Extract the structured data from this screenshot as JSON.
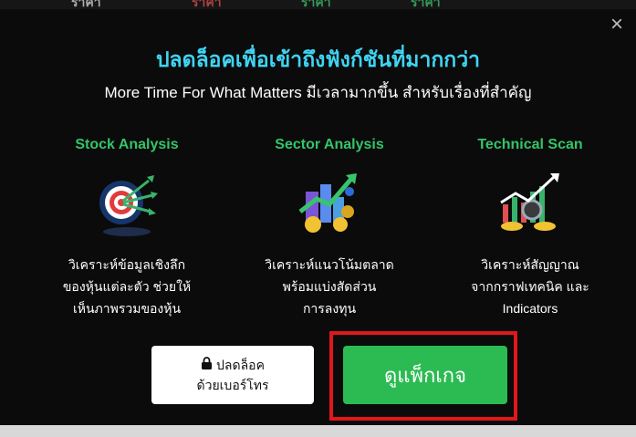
{
  "background_strip": [
    "ราคา",
    "ราคา",
    "ราคา",
    "ราคา"
  ],
  "modal": {
    "close_label": "×",
    "title": "ปลดล็อคเพื่อเข้าถึงฟังก์ชันที่มากกว่า",
    "subtitle": "More Time For What Matters มีเวลามากขึ้น สำหรับเรื่องที่สำคัญ",
    "features": [
      {
        "title": "Stock Analysis",
        "icon": "target-icon",
        "desc_lines": [
          "วิเคราะห์ข้อมูลเชิงลึก",
          "ของหุ้นแต่ละตัว ช่วยให้",
          "เห็นภาพรวมของหุ้น"
        ]
      },
      {
        "title": "Sector Analysis",
        "icon": "sector-growth-icon",
        "desc_lines": [
          "วิเคราะห์แนวโน้มตลาด",
          "พร้อมแบ่งสัดส่วน",
          "การลงทุน"
        ]
      },
      {
        "title": "Technical Scan",
        "icon": "technical-chart-icon",
        "desc_lines": [
          "วิเคราะห์สัญญาณ",
          "จากกราฟเทคนิค และ",
          "Indicators"
        ]
      }
    ],
    "buttons": {
      "unlock_line1": "ปลดล็อค",
      "unlock_line2": "ด้วยเบอร์โทร",
      "view_package": "ดูแพ็กเกจ"
    }
  },
  "colors": {
    "title": "#3fd4f2",
    "feature_title": "#34c46a",
    "primary_button": "#2bbb52",
    "highlight_border": "#e0171b"
  }
}
